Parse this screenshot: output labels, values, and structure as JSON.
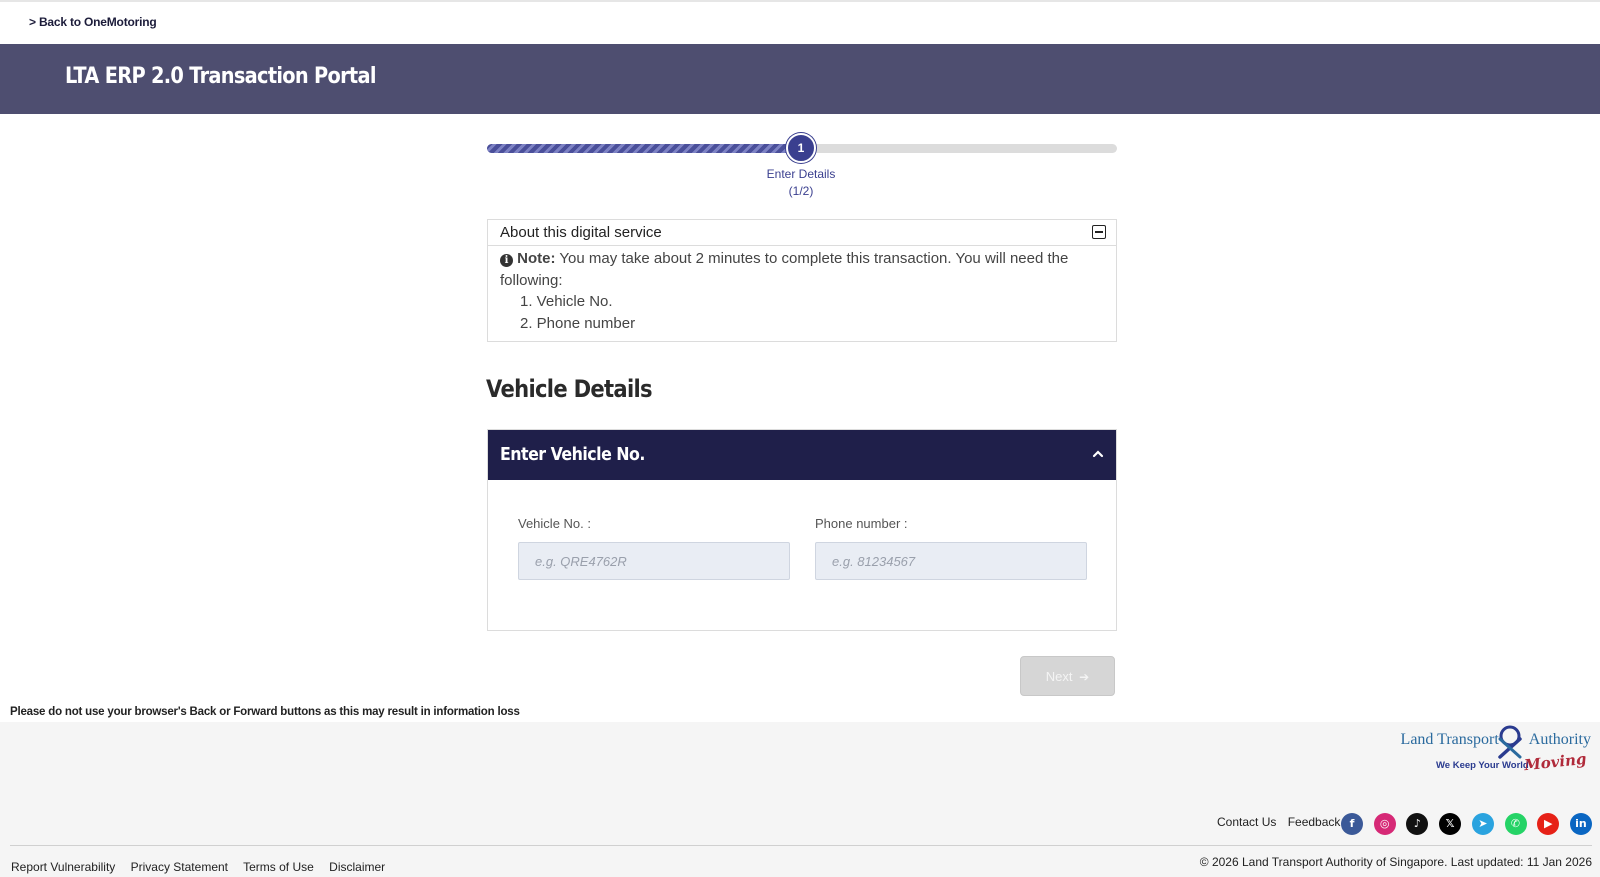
{
  "nav": {
    "back_link": "> Back to OneMotoring"
  },
  "header": {
    "title": "LTA ERP 2.0 Transaction Portal"
  },
  "stepper": {
    "step_number": "1",
    "step_label": "Enter Details",
    "step_count": "(1/2)",
    "progress_fraction": 0.48
  },
  "about": {
    "title": "About this digital service",
    "note_label": "Note:",
    "note_text": " You may take about 2 minutes to complete this transaction. You will need the following:",
    "items": [
      "1. Vehicle No.",
      "2. Phone number"
    ]
  },
  "vehicle": {
    "section_title": "Vehicle Details",
    "card_title": "Enter Vehicle No.",
    "vehicle_label": "Vehicle No. :",
    "vehicle_placeholder": "e.g. QRE4762R",
    "phone_label": "Phone number :",
    "phone_placeholder": "e.g. 81234567"
  },
  "actions": {
    "next_label": "Next",
    "next_arrow": "➔"
  },
  "warning": "Please do not use your browser's Back or Forward buttons as this may result in information loss",
  "logo": {
    "main_left": "Land Transport",
    "main_right": "Authority",
    "tagline": "We Keep Your World",
    "moving": "Moving"
  },
  "footer": {
    "contact": "Contact Us",
    "feedback": "Feedback",
    "social": [
      {
        "icon": "facebook-icon",
        "glyph": "f",
        "color": "#3b5998"
      },
      {
        "icon": "instagram-icon",
        "glyph": "◎",
        "color": "#d62976"
      },
      {
        "icon": "tiktok-icon",
        "glyph": "♪",
        "color": "#111111"
      },
      {
        "icon": "x-icon",
        "glyph": "𝕏",
        "color": "#000000"
      },
      {
        "icon": "telegram-icon",
        "glyph": "➤",
        "color": "#2aa3df"
      },
      {
        "icon": "whatsapp-icon",
        "glyph": "✆",
        "color": "#25d366"
      },
      {
        "icon": "youtube-icon",
        "glyph": "▶",
        "color": "#e62117"
      },
      {
        "icon": "linkedin-icon",
        "glyph": "in",
        "color": "#0a66c2"
      }
    ],
    "links": [
      "Report Vulnerability",
      "Privacy Statement",
      "Terms of Use",
      "Disclaimer"
    ],
    "copyright": "© 2026 Land Transport Authority of Singapore. Last updated: 11 Jan 2026"
  }
}
